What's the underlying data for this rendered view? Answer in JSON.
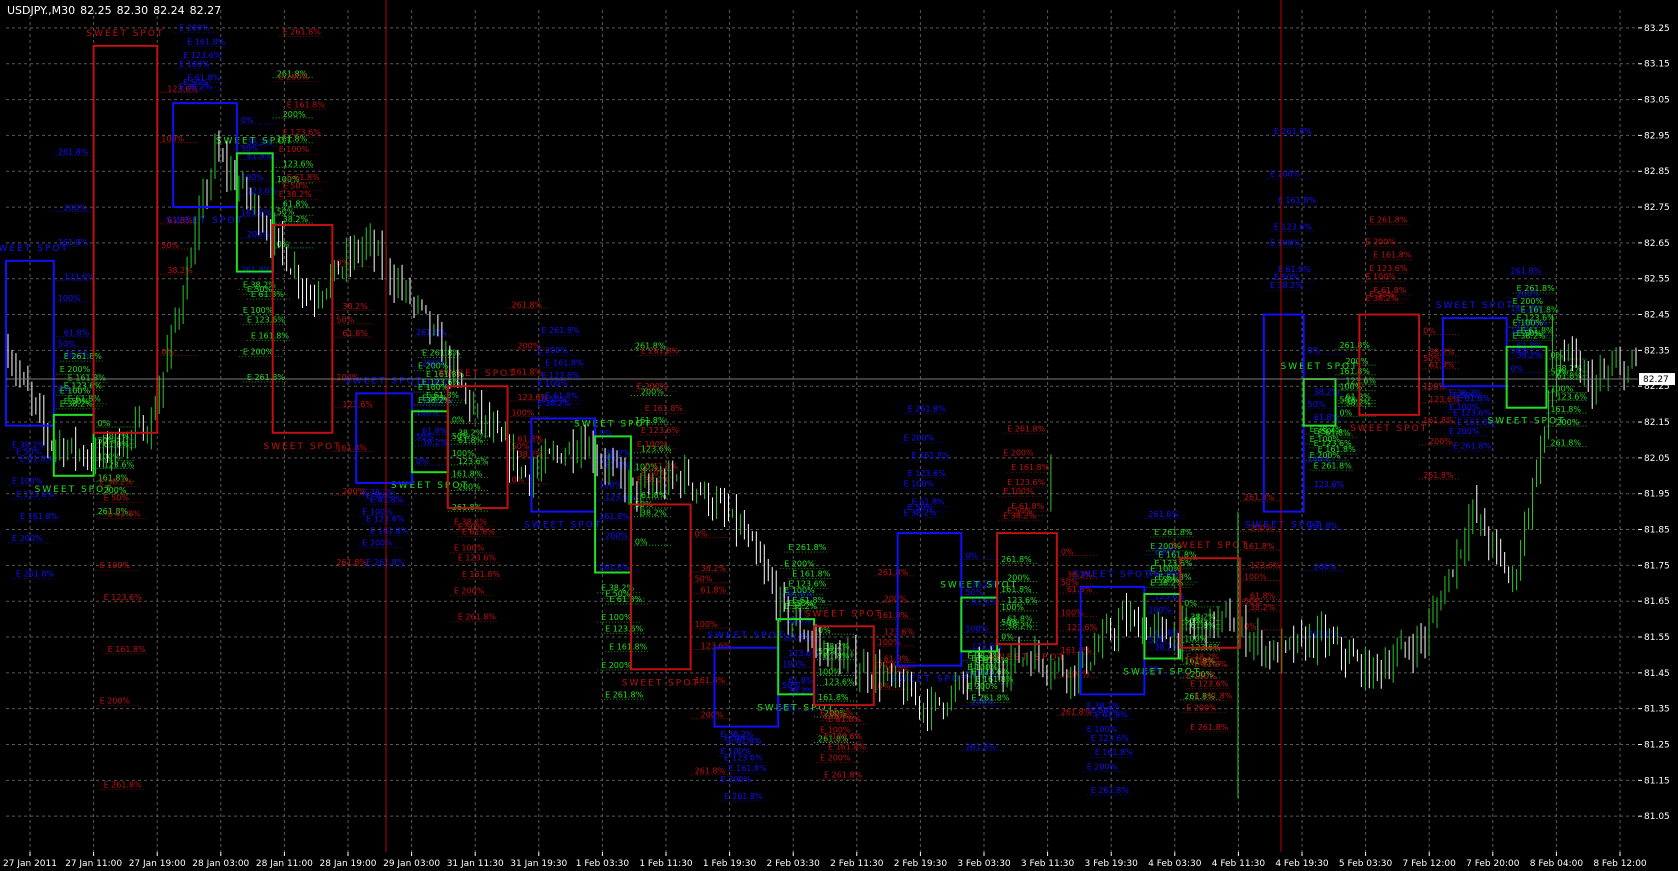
{
  "header": {
    "symbol": "USDJPY.,M30",
    "open": "82.25",
    "high": "82.30",
    "low": "82.24",
    "close": "82.27"
  },
  "colors": {
    "background": "#000000",
    "grid": "#5a5a5a",
    "bull_bar": "#28c828",
    "bear_bar": "#ffffff",
    "box_blue": "#1010ff",
    "box_green": "#20e020",
    "box_red": "#c01010",
    "vline": "#c00000",
    "bid_line": "#7a7a7a"
  },
  "chart_data": {
    "type": "ohlc",
    "symbol": "USDJPY.",
    "timeframe": "M30",
    "ylim": [
      80.95,
      83.3
    ],
    "y_ticks": [
      "83.25",
      "83.15",
      "83.05",
      "82.95",
      "82.85",
      "82.75",
      "82.65",
      "82.55",
      "82.45",
      "82.35",
      "82.25",
      "82.15",
      "82.05",
      "81.95",
      "81.85",
      "81.75",
      "81.65",
      "81.55",
      "81.45",
      "81.35",
      "81.25",
      "81.15",
      "81.05"
    ],
    "x_ticks": [
      "27 Jan 2011",
      "27 Jan 11:00",
      "27 Jan 19:00",
      "28 Jan 03:00",
      "28 Jan 11:00",
      "28 Jan 19:00",
      "29 Jan 03:00",
      "31 Jan 11:30",
      "31 Jan 19:30",
      "1 Feb 03:30",
      "1 Feb 11:30",
      "1 Feb 19:30",
      "2 Feb 03:30",
      "2 Feb 11:30",
      "2 Feb 19:30",
      "3 Feb 03:30",
      "3 Feb 11:30",
      "3 Feb 19:30",
      "4 Feb 03:30",
      "4 Feb 11:30",
      "4 Feb 19:30",
      "5 Feb 03:30",
      "7 Feb 12:00",
      "7 Feb 20:00",
      "8 Feb 04:00",
      "8 Feb 12:00"
    ],
    "current_price": "82.27",
    "price_path": [
      [
        0,
        82.35
      ],
      [
        10,
        82.1
      ],
      [
        22,
        82.05
      ],
      [
        36,
        82.15
      ],
      [
        52,
        82.9
      ],
      [
        62,
        82.75
      ],
      [
        76,
        82.5
      ],
      [
        90,
        82.65
      ],
      [
        104,
        82.45
      ],
      [
        116,
        82.2
      ],
      [
        130,
        82.0
      ],
      [
        144,
        82.1
      ],
      [
        158,
        81.95
      ],
      [
        170,
        82.0
      ],
      [
        184,
        81.85
      ],
      [
        196,
        81.6
      ],
      [
        206,
        81.5
      ],
      [
        218,
        81.45
      ],
      [
        232,
        81.35
      ],
      [
        244,
        81.45
      ],
      [
        256,
        81.5
      ],
      [
        268,
        81.45
      ],
      [
        280,
        81.6
      ],
      [
        292,
        81.55
      ],
      [
        306,
        81.6
      ],
      [
        318,
        81.5
      ],
      [
        330,
        81.55
      ],
      [
        342,
        81.45
      ],
      [
        356,
        81.55
      ],
      [
        368,
        81.9
      ],
      [
        378,
        81.7
      ],
      [
        390,
        82.35
      ],
      [
        398,
        82.25
      ],
      [
        404,
        82.3
      ]
    ],
    "sweet_spot_label": "SWEET SPOT",
    "box_labels": {
      "l0": "0%",
      "l38": "38.2%",
      "l50": "50%",
      "l61": "61.8%",
      "l100": "100%",
      "l123": "123.6%",
      "l161": "161.8%",
      "l200": "200%",
      "l261": "261.8%",
      "e38": "E 38.2%",
      "e50": "E 50%",
      "e61": "E 61.8%",
      "e100": "E 100%",
      "e123": "E 123.6%",
      "e161": "E 161.8%",
      "e200": "E 200%",
      "e261": "E 261.8%"
    },
    "zones": [
      {
        "from": 0,
        "to": 12,
        "high": 82.6,
        "low": 82.14,
        "color": "blue"
      },
      {
        "from": 12,
        "to": 22,
        "high": 82.17,
        "low": 82.0,
        "color": "green"
      },
      {
        "from": 22,
        "to": 38,
        "high": 83.2,
        "low": 82.12,
        "color": "red"
      },
      {
        "from": 42,
        "to": 58,
        "high": 83.04,
        "low": 82.75,
        "color": "blue"
      },
      {
        "from": 58,
        "to": 67,
        "high": 82.9,
        "low": 82.57,
        "color": "green"
      },
      {
        "from": 67,
        "to": 82,
        "high": 82.7,
        "low": 82.12,
        "color": "red"
      },
      {
        "from": 88,
        "to": 102,
        "high": 82.23,
        "low": 81.98,
        "color": "blue"
      },
      {
        "from": 102,
        "to": 111,
        "high": 82.18,
        "low": 82.01,
        "color": "green"
      },
      {
        "from": 111,
        "to": 126,
        "high": 82.25,
        "low": 81.91,
        "color": "red"
      },
      {
        "from": 132,
        "to": 148,
        "high": 82.16,
        "low": 81.9,
        "color": "blue"
      },
      {
        "from": 148,
        "to": 157,
        "high": 82.11,
        "low": 81.73,
        "color": "green"
      },
      {
        "from": 157,
        "to": 172,
        "high": 81.92,
        "low": 81.46,
        "color": "red"
      },
      {
        "from": 178,
        "to": 194,
        "high": 81.52,
        "low": 81.3,
        "color": "blue"
      },
      {
        "from": 194,
        "to": 203,
        "high": 81.6,
        "low": 81.39,
        "color": "green"
      },
      {
        "from": 203,
        "to": 218,
        "high": 81.58,
        "low": 81.36,
        "color": "red"
      },
      {
        "from": 224,
        "to": 240,
        "high": 81.84,
        "low": 81.47,
        "color": "blue"
      },
      {
        "from": 240,
        "to": 249,
        "high": 81.66,
        "low": 81.51,
        "color": "green"
      },
      {
        "from": 249,
        "to": 264,
        "high": 81.84,
        "low": 81.53,
        "color": "red"
      },
      {
        "from": 270,
        "to": 286,
        "high": 81.69,
        "low": 81.39,
        "color": "blue"
      },
      {
        "from": 286,
        "to": 295,
        "high": 81.67,
        "low": 81.49,
        "color": "green"
      },
      {
        "from": 295,
        "to": 310,
        "high": 81.77,
        "low": 81.52,
        "color": "red"
      },
      {
        "from": 316,
        "to": 326,
        "high": 82.45,
        "low": 81.9,
        "color": "blue"
      },
      {
        "from": 326,
        "to": 334,
        "high": 82.27,
        "low": 82.14,
        "color": "green"
      },
      {
        "from": 340,
        "to": 355,
        "high": 82.45,
        "low": 82.17,
        "color": "red"
      },
      {
        "from": 361,
        "to": 377,
        "high": 82.44,
        "low": 82.25,
        "color": "blue"
      },
      {
        "from": 377,
        "to": 387,
        "high": 82.36,
        "low": 82.19,
        "color": "green"
      }
    ]
  }
}
